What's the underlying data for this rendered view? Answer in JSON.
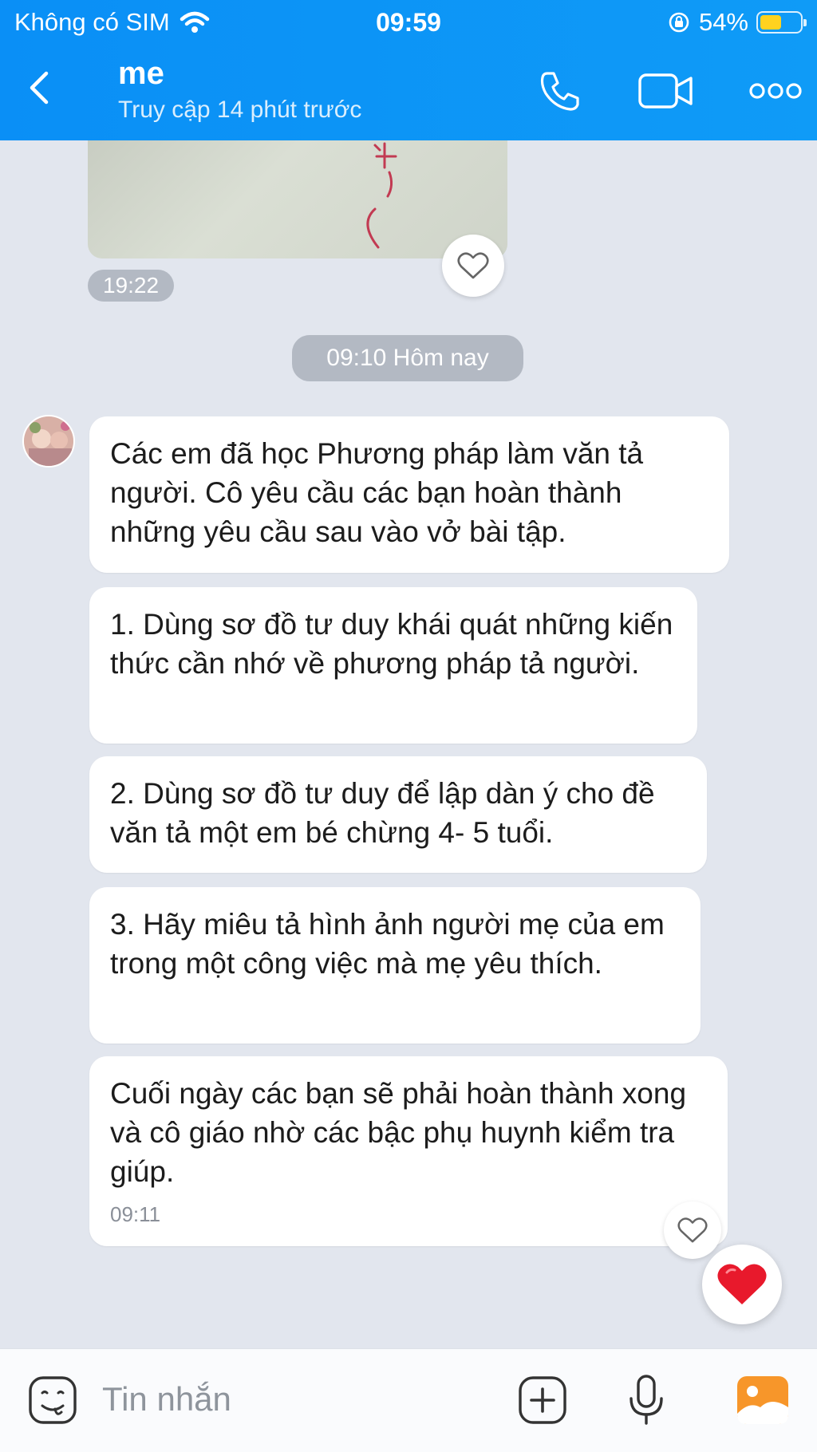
{
  "status_bar": {
    "carrier": "Không có SIM",
    "time": "09:59",
    "battery": "54%",
    "battery_level": 0.54
  },
  "header": {
    "title": "me",
    "subtitle": "Truy cập 14 phút trước",
    "icons": [
      "back-icon",
      "phone-icon",
      "video-call-icon",
      "more-icon"
    ]
  },
  "chat": {
    "image_time": "19:22",
    "date_separator": "09:10 Hôm nay",
    "messages": [
      {
        "text": "Các em đã học Phương pháp làm văn tả người. Cô yêu cầu các bạn hoàn thành những yêu cầu sau vào vở bài tập."
      },
      {
        "text": "1. Dùng sơ đồ tư duy khái quát những kiến thức cần nhớ về phương pháp tả người."
      },
      {
        "text": "2. Dùng sơ đồ tư duy để lập dàn ý cho đề văn tả một em bé chừng 4- 5 tuổi."
      },
      {
        "text": "3. Hãy miêu tả hình ảnh người mẹ của em trong một công việc mà mẹ yêu thích."
      },
      {
        "text": "Cuối ngày các bạn sẽ phải hoàn thành xong và cô giáo nhờ các bậc phụ huynh kiểm tra giúp.",
        "time": "09:11"
      }
    ]
  },
  "input_bar": {
    "placeholder": "Tin nhắn",
    "icons": [
      "sticker-icon",
      "add-icon",
      "microphone-icon",
      "gallery-icon"
    ]
  },
  "colors": {
    "header": "#0a8ff6",
    "chat_bg": "#e2e6ee",
    "bubble": "#ffffff",
    "heart": "#e8192c",
    "gallery": "#f7962a"
  }
}
